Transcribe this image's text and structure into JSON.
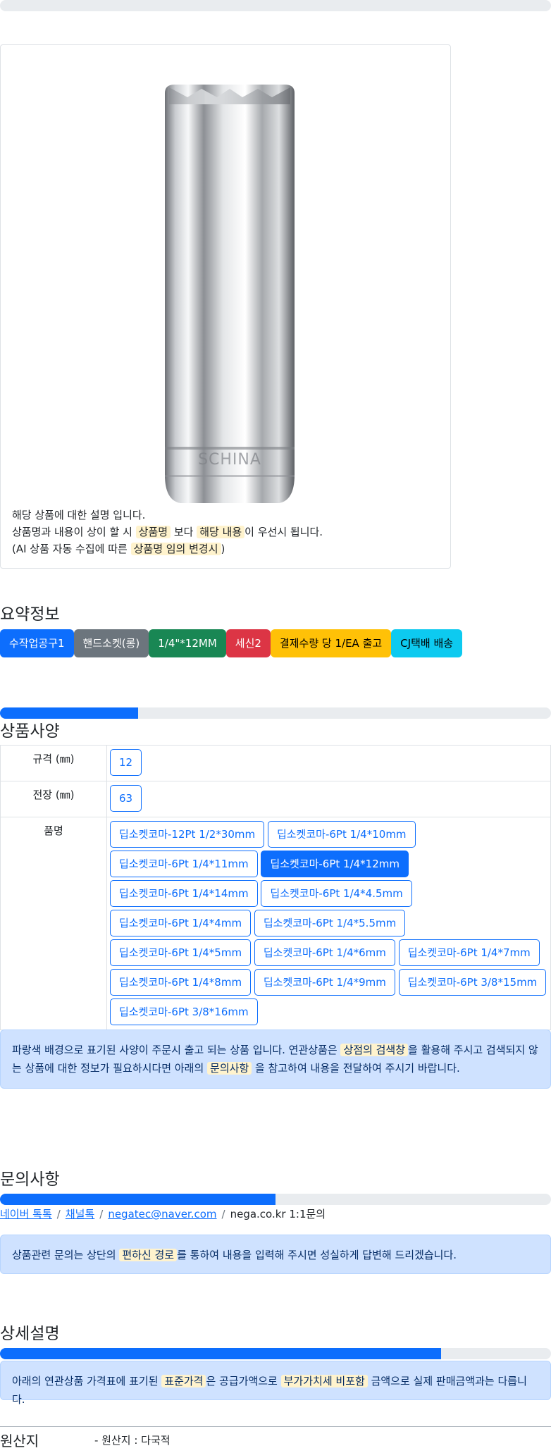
{
  "product": {
    "image_name": "deep-socket-image",
    "brand_engraving": "SCHINA",
    "description_lines": {
      "line1": "해당 상품에 대한 설명 입니다.",
      "line2_pre": "상품명과 내용이 상이 할 시 ",
      "line2_hl1": "상품명",
      "line2_mid": " 보다 ",
      "line2_hl2": "해당 내용",
      "line2_post": "이 우선시 됩니다.",
      "line3_pre": "(AI 상품 자동 수집에 따른 ",
      "line3_hl": "상품명 임의 변경시",
      "line3_post": ")"
    }
  },
  "summary": {
    "title": "요약정보",
    "badges": [
      {
        "label": "수작업공구1",
        "color": "#0d6efd"
      },
      {
        "label": "핸드소켓(롱)",
        "color": "#6c757d"
      },
      {
        "label": "1/4\"*12MM",
        "color": "#198754"
      },
      {
        "label": "세신2",
        "color": "#dc3545"
      },
      {
        "label": "결제수량 당 1/EA 출고",
        "color": "#ffc107"
      },
      {
        "label": "CJ택배 배송",
        "color": "#0dcaf0"
      }
    ]
  },
  "spec": {
    "progress_percent": 25,
    "title": "상품사양",
    "rows": {
      "size_label": "규격 (㎜)",
      "size_value": "12",
      "length_label": "전장 (㎜)",
      "length_value": "63",
      "name_label": "품명"
    },
    "options": [
      {
        "label": "딥소켓코마-12Pt 1/2*30mm",
        "active": false
      },
      {
        "label": "딥소켓코마-6Pt 1/4*10mm",
        "active": false
      },
      {
        "label": "딥소켓코마-6Pt 1/4*11mm",
        "active": false
      },
      {
        "label": "딥소켓코마-6Pt 1/4*12mm",
        "active": true
      },
      {
        "label": "딥소켓코마-6Pt 1/4*14mm",
        "active": false
      },
      {
        "label": "딥소켓코마-6Pt 1/4*4.5mm",
        "active": false
      },
      {
        "label": "딥소켓코마-6Pt 1/4*4mm",
        "active": false
      },
      {
        "label": "딥소켓코마-6Pt 1/4*5.5mm",
        "active": false
      },
      {
        "label": "딥소켓코마-6Pt 1/4*5mm",
        "active": false
      },
      {
        "label": "딥소켓코마-6Pt 1/4*6mm",
        "active": false
      },
      {
        "label": "딥소켓코마-6Pt 1/4*7mm",
        "active": false
      },
      {
        "label": "딥소켓코마-6Pt 1/4*8mm",
        "active": false
      },
      {
        "label": "딥소켓코마-6Pt 1/4*9mm",
        "active": false
      },
      {
        "label": "딥소켓코마-6Pt 3/8*15mm",
        "active": false
      },
      {
        "label": "딥소켓코마-6Pt 3/8*16mm",
        "active": false
      }
    ],
    "notice": {
      "pre": "파랑색 배경으로 표기된 사양이 주문시 출고 되는 상품 입니다. 연관상품은 ",
      "hl1": "상점의 검색창",
      "mid": "을 활용해 주시고 검색되지 않는 상품에 대한 정보가 필요하시다면 아래의 ",
      "hl2": "문의사항",
      "post": " 을 참고하여 내용을 전달하여 주시기 바랍니다."
    }
  },
  "inquiry": {
    "title": "문의사항",
    "progress_percent": 50,
    "links": {
      "naver": "네이버 톡톡",
      "channel": "채널톡",
      "email": "negatec@naver.com",
      "site": "nega.co.kr 1:1문의"
    },
    "notice": {
      "pre": "상품관련 문의는 상단의 ",
      "hl": "편하신 경로",
      "post": "를 통하여 내용을 입력해 주시면 성실하게 답변해 드리겠습니다."
    }
  },
  "detail": {
    "title": "상세설명",
    "progress_percent": 80,
    "notice": {
      "pre": "아래의 연관상품 가격표에 표기된 ",
      "hl1": "표준가격",
      "mid": "은 공급가액으로 ",
      "hl2": "부가가치세 비포함",
      "post": " 금액으로 실제 판매금액과는 다릅니다."
    }
  },
  "origin": {
    "label": "원산지",
    "value": "- 원산지 : 다국적"
  }
}
